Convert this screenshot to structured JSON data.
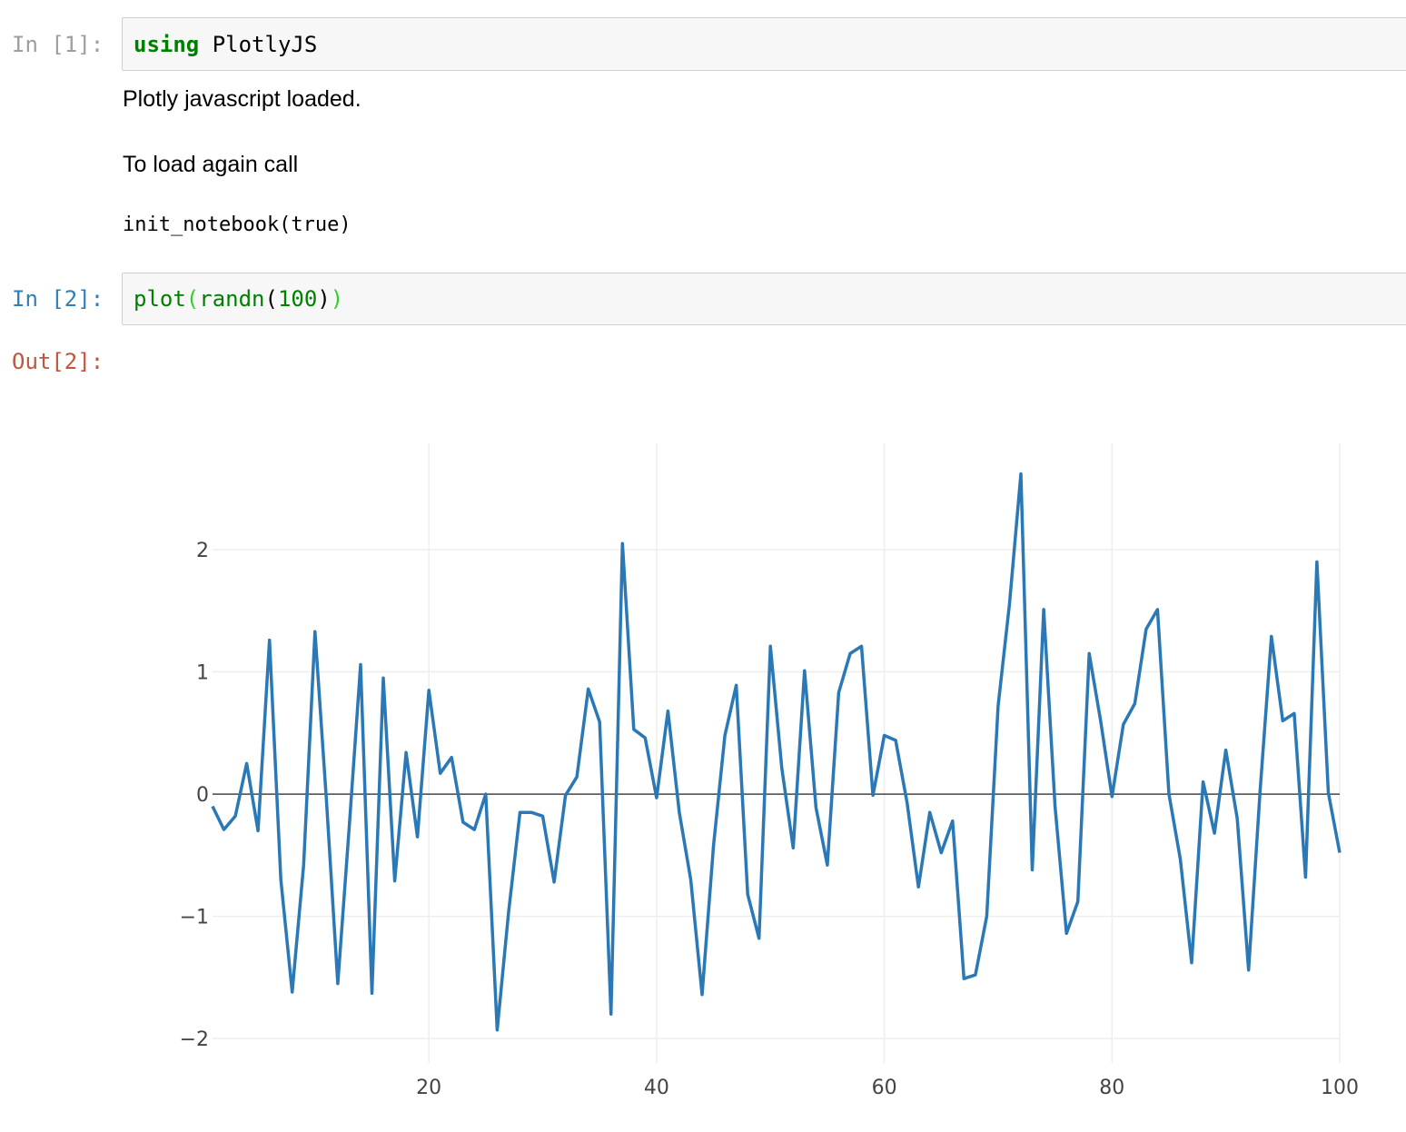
{
  "cells": [
    {
      "prompt": "In [1]:",
      "code": {
        "keyword": "using",
        "rest": " PlotlyJS"
      },
      "outputs": {
        "line1": "Plotly javascript loaded.",
        "line2": "To load again call",
        "code": "init_notebook(true)"
      }
    },
    {
      "prompt": "In [2]:",
      "code": {
        "fn": "plot",
        "open_paren": "(",
        "inner_fn": "randn",
        "inner_open": "(",
        "arg": "100",
        "inner_close": ")",
        "close_paren": ")"
      },
      "out_prompt": "Out[2]:"
    }
  ],
  "colors": {
    "line": "#2a78b5",
    "grid": "#eeeeee",
    "zeroline": "#444444"
  },
  "chart_data": {
    "type": "line",
    "x_ticks": [
      "20",
      "40",
      "60",
      "80",
      "100"
    ],
    "x_tick_values": [
      20,
      40,
      60,
      80,
      100
    ],
    "y_ticks": [
      "−2",
      "−1",
      "0",
      "1",
      "2"
    ],
    "y_tick_values": [
      -2,
      -1,
      0,
      1,
      2
    ],
    "xlim": [
      1,
      100
    ],
    "ylim": [
      -2.2,
      2.87
    ],
    "grid": true,
    "series": [
      {
        "x": [
          1,
          2,
          3,
          4,
          5,
          6,
          7,
          8,
          9,
          10,
          11,
          12,
          13,
          14,
          15,
          16,
          17,
          18,
          19,
          20,
          21,
          22,
          23,
          24,
          25,
          26,
          27,
          28,
          29,
          30,
          31,
          32,
          33,
          34,
          35,
          36,
          37,
          38,
          39,
          40,
          41,
          42,
          43,
          44,
          45,
          46,
          47,
          48,
          49,
          50,
          51,
          52,
          53,
          54,
          55,
          56,
          57,
          58,
          59,
          60,
          61,
          62,
          63,
          64,
          65,
          66,
          67,
          68,
          69,
          70,
          71,
          72,
          73,
          74,
          75,
          76,
          77,
          78,
          79,
          80,
          81,
          82,
          83,
          84,
          85,
          86,
          87,
          88,
          89,
          90,
          91,
          92,
          93,
          94,
          95,
          96,
          97,
          98,
          99,
          100
        ],
        "values": [
          -0.1,
          -0.29,
          -0.18,
          0.25,
          -0.3,
          1.26,
          -0.7,
          -1.62,
          -0.58,
          1.33,
          -0.05,
          -1.55,
          -0.28,
          1.06,
          -1.63,
          0.95,
          -0.71,
          0.34,
          -0.35,
          0.85,
          0.17,
          0.3,
          -0.23,
          -0.29,
          0.0,
          -1.93,
          -0.97,
          -0.15,
          -0.15,
          -0.18,
          -0.72,
          -0.01,
          0.14,
          0.86,
          0.59,
          -1.8,
          2.05,
          0.53,
          0.46,
          -0.03,
          0.68,
          -0.15,
          -0.7,
          -1.64,
          -0.42,
          0.48,
          0.89,
          -0.82,
          -1.18,
          1.21,
          0.21,
          -0.44,
          1.01,
          -0.11,
          -0.58,
          0.83,
          1.15,
          1.21,
          -0.01,
          0.48,
          0.44,
          -0.07,
          -0.76,
          -0.15,
          -0.48,
          -0.22,
          -1.51,
          -1.48,
          -1.0,
          0.72,
          1.56,
          2.62,
          -0.62,
          1.51,
          -0.1,
          -1.14,
          -0.88,
          1.15,
          0.6,
          -0.02,
          0.57,
          0.74,
          1.35,
          1.51,
          0.0,
          -0.53,
          -1.38,
          0.1,
          -0.32,
          0.36,
          -0.2,
          -1.44,
          0.02,
          1.29,
          0.6,
          0.66,
          -0.68,
          1.9,
          0.01,
          -0.48
        ]
      }
    ]
  }
}
